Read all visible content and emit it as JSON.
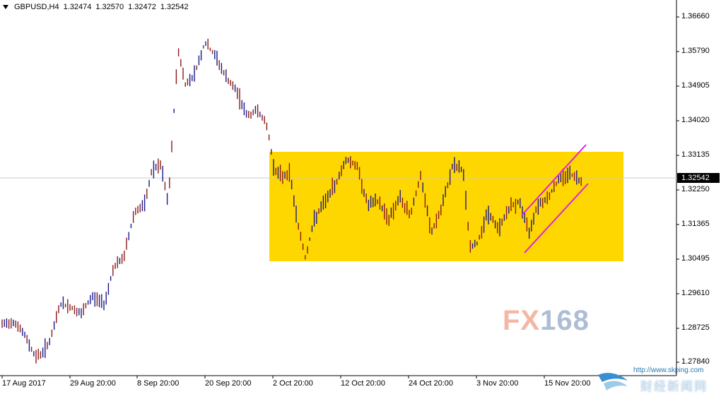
{
  "header": {
    "symbol": "GBPUSD,H4",
    "open": "1.32474",
    "high": "1.32570",
    "low": "1.32472",
    "close": "1.32542"
  },
  "y_axis": [
    "1.36660",
    "1.35790",
    "1.34905",
    "1.34020",
    "1.33135",
    "1.32250",
    "1.31365",
    "1.30495",
    "1.29610",
    "1.28725",
    "1.27840"
  ],
  "current_price": "1.32542",
  "x_axis": [
    "17 Aug 2017",
    "29 Aug 20:00",
    "8 Sep 20:00",
    "20 Sep 20:00",
    "2 Oct 20:00",
    "12 Oct 20:00",
    "24 Oct 20:00",
    "3 Nov 20:00",
    "15 Nov 20:00"
  ],
  "watermark": {
    "part1": "FX",
    "part2": "168"
  },
  "corner": {
    "url": "http://www.skping.com",
    "name": "财经新闻网"
  },
  "colors": {
    "range_box": "#ffd700",
    "channel": "#e020e0",
    "candles": "#1a1a8c",
    "wick_alt": "#8b1a1a"
  }
}
